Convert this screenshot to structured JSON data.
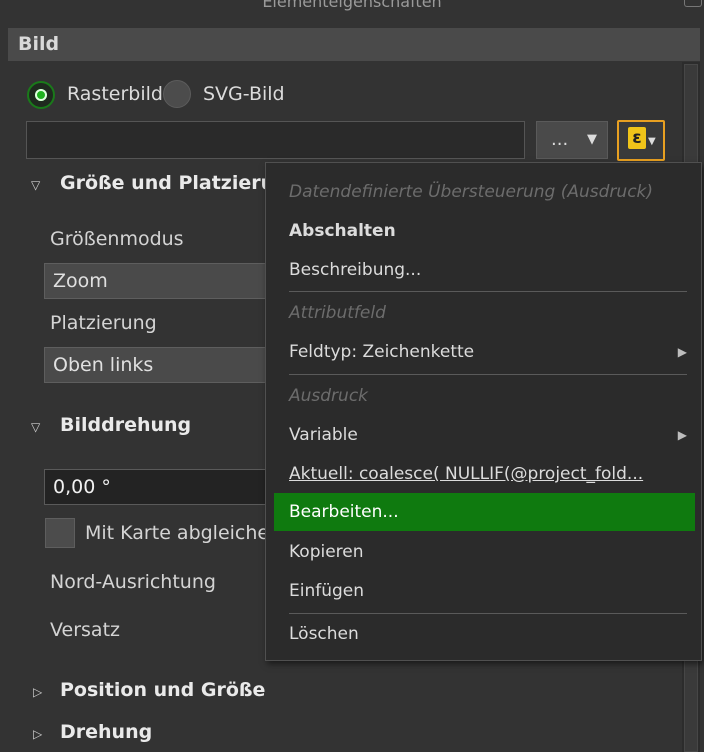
{
  "window": {
    "title": "Elementeigenschaften"
  },
  "section": {
    "title": "Bild"
  },
  "image_type": {
    "raster_label": "Rasterbild",
    "svg_label": "SVG-Bild",
    "selected": "Rasterbild"
  },
  "source": {
    "path_value": "",
    "browse_label": "...",
    "browse_arrow": "▼",
    "dd_symbol": "ε",
    "dd_caret": "▼"
  },
  "groups": {
    "size": {
      "title": "Größe und Platzierung",
      "mode_label": "Größenmodus",
      "mode_value": "Zoom",
      "placement_label": "Platzierung",
      "placement_value": "Oben links"
    },
    "rotation": {
      "title": "Bilddrehung",
      "value": "0,00 °",
      "sync_label": "Mit Karte abgleichen",
      "north_label": "Nord-Ausrichtung",
      "offset_label": "Versatz"
    },
    "position": {
      "title": "Position und Größe"
    },
    "drehung": {
      "title": "Drehung"
    }
  },
  "menu": {
    "header": "Datendefinierte Übersteuerung (Ausdruck)",
    "deactivate": "Abschalten",
    "description": "Beschreibung...",
    "attr_section": "Attributfeld",
    "field_type": "Feldtyp: Zeichenkette",
    "expr_section": "Ausdruck",
    "variable": "Variable",
    "current": "Aktuell: coalesce(      NULLIF(@project_fold...",
    "edit": "Bearbeiten...",
    "copy": "Kopieren",
    "paste": "Einfügen",
    "delete": "Löschen",
    "submenu_arrow": "▶",
    "highlight_color": "#0f7a0f"
  },
  "icons": {
    "expanded": "▽",
    "collapsed": "▷"
  }
}
